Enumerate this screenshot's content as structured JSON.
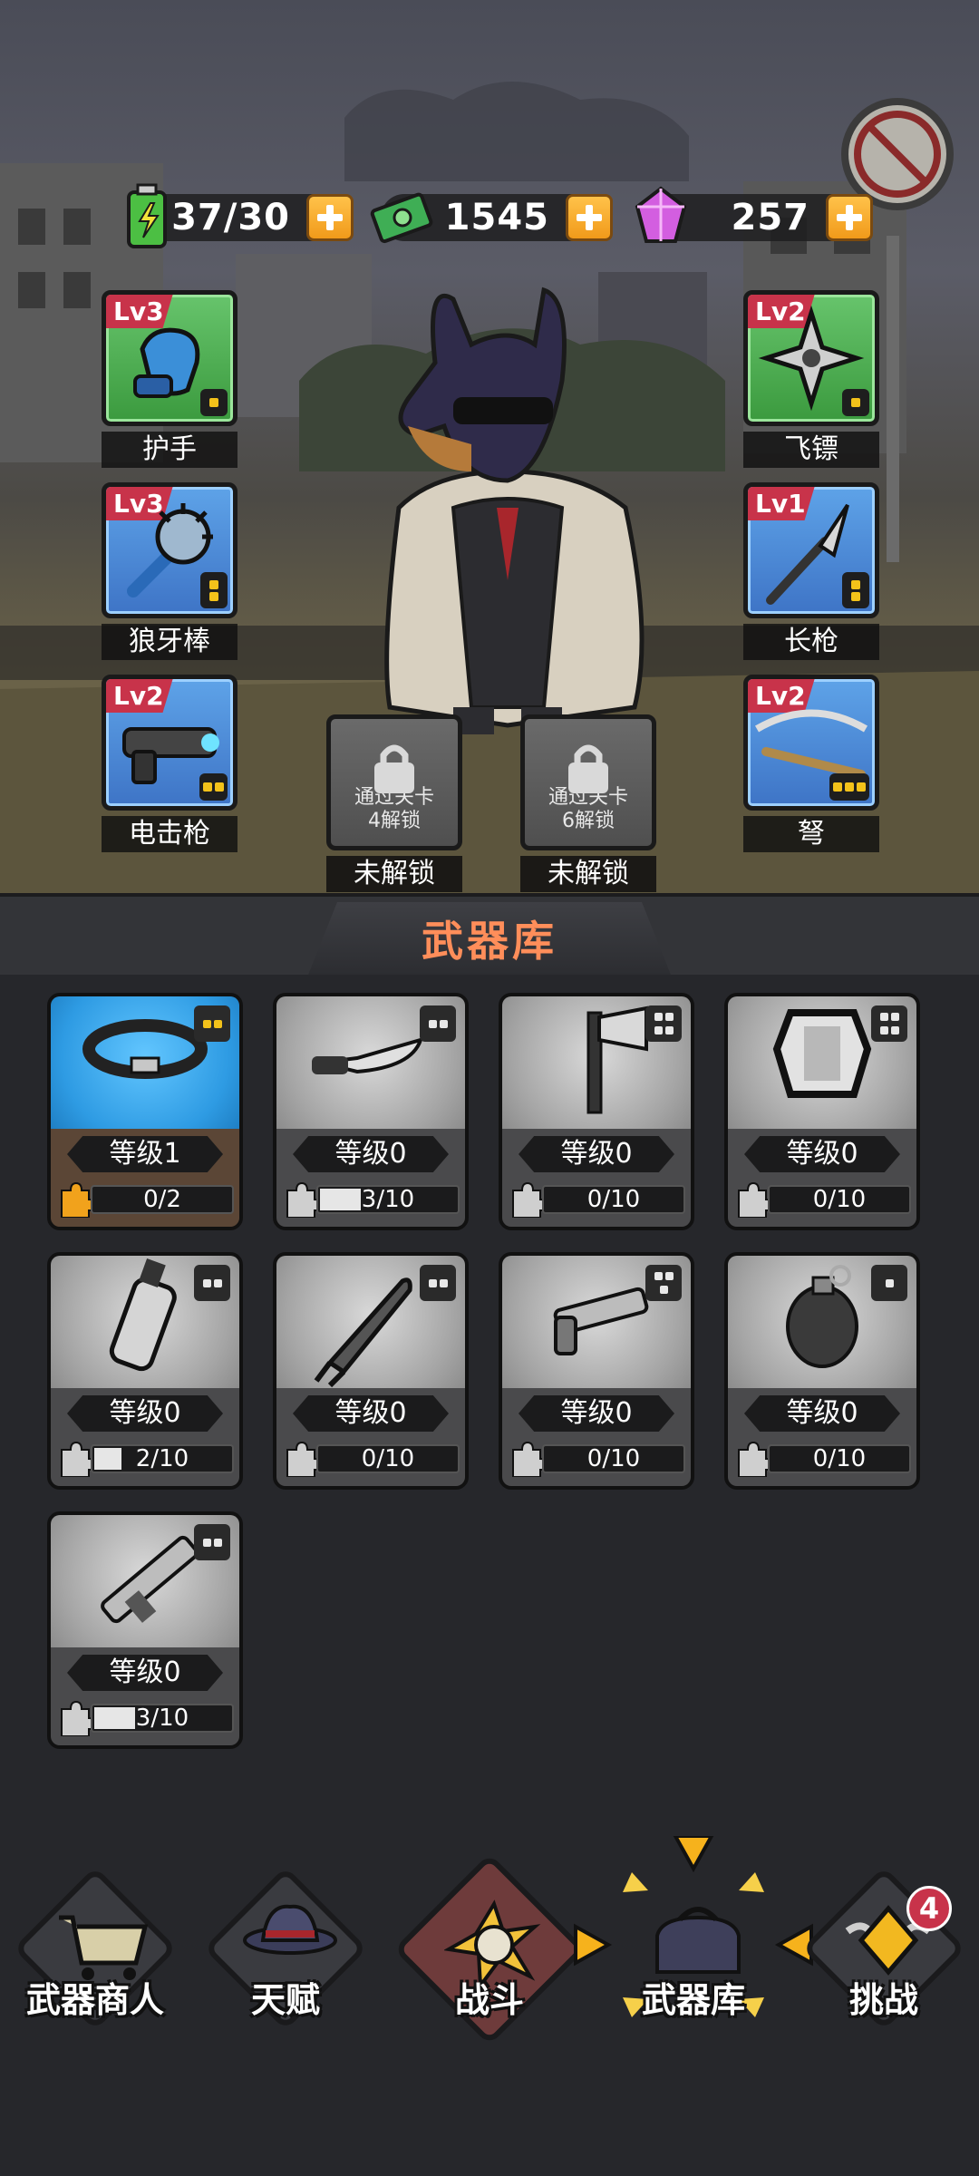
{
  "hud": {
    "energy": "37/30",
    "cash": "1545",
    "gems": "257"
  },
  "equipped": [
    {
      "level": "Lv3",
      "name": "护手",
      "tier": "green"
    },
    {
      "level": "Lv2",
      "name": "飞镖",
      "tier": "green"
    },
    {
      "level": "Lv3",
      "name": "狼牙棒",
      "tier": "blue"
    },
    {
      "level": "Lv1",
      "name": "长枪",
      "tier": "blue"
    },
    {
      "level": "Lv2",
      "name": "电击枪",
      "tier": "blue"
    },
    {
      "level": "Lv2",
      "name": "弩",
      "tier": "blue"
    }
  ],
  "locked_slots": [
    {
      "text1": "通过关卡",
      "text2": "4解锁",
      "label": "未解锁"
    },
    {
      "text1": "通过关卡",
      "text2": "6解锁",
      "label": "未解锁"
    }
  ],
  "armory": {
    "title": "武器库",
    "items": [
      {
        "icon": "collar-icon",
        "level": "等级1",
        "progress": "0/2",
        "fill": 0,
        "active": true
      },
      {
        "icon": "knife-icon",
        "level": "等级0",
        "progress": "3/10",
        "fill": 0.3
      },
      {
        "icon": "axe-icon",
        "level": "等级0",
        "progress": "0/10",
        "fill": 0
      },
      {
        "icon": "shield-icon",
        "level": "等级0",
        "progress": "0/10",
        "fill": 0
      },
      {
        "icon": "gas-canister-icon",
        "level": "等级0",
        "progress": "2/10",
        "fill": 0.2
      },
      {
        "icon": "rocket-icon",
        "level": "等级0",
        "progress": "0/10",
        "fill": 0
      },
      {
        "icon": "flare-gun-icon",
        "level": "等级0",
        "progress": "0/10",
        "fill": 0
      },
      {
        "icon": "grenade-icon",
        "level": "等级0",
        "progress": "0/10",
        "fill": 0
      },
      {
        "icon": "rocket-launcher-icon",
        "level": "等级0",
        "progress": "3/10",
        "fill": 0.3
      }
    ]
  },
  "nav": {
    "shop": "武器商人",
    "talent": "天赋",
    "battle": "战斗",
    "armory": "武器库",
    "challenge": "挑战",
    "challenge_badge": "4"
  },
  "colors": {
    "accent_orange": "#f19a1a",
    "title_orange": "#ff8e5a",
    "level_red": "#c8334a",
    "rank_yellow": "#f3c21a"
  }
}
